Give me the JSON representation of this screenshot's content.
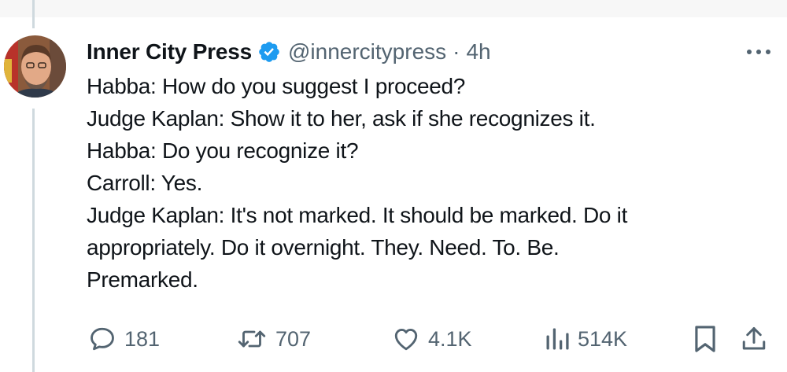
{
  "tweet": {
    "author": {
      "display_name": "Inner City Press",
      "handle": "@innercitypress",
      "verified": true
    },
    "separator": "·",
    "time": "4h",
    "lines": [
      "Habba: How do you suggest I proceed?",
      "Judge Kaplan: Show it to her, ask if she recognizes it.",
      "Habba: Do you recognize it?",
      "Carroll: Yes.",
      "Judge Kaplan: It's not marked. It should be marked. Do it",
      "appropriately. Do it overnight. They. Need. To. Be.",
      "Premarked."
    ],
    "actions": {
      "replies": "181",
      "reposts": "707",
      "likes": "4.1K",
      "views": "514K"
    }
  },
  "colors": {
    "text": "#0f1419",
    "secondary": "#536471",
    "verified_blue": "#1d9bf0",
    "thread_line": "#cfd9de"
  },
  "icons": {
    "more": "more-horizontal-icon",
    "reply": "reply-icon",
    "repost": "repost-icon",
    "like": "heart-icon",
    "views": "views-chart-icon",
    "bookmark": "bookmark-icon",
    "share": "share-icon",
    "verified": "verified-badge-icon"
  }
}
